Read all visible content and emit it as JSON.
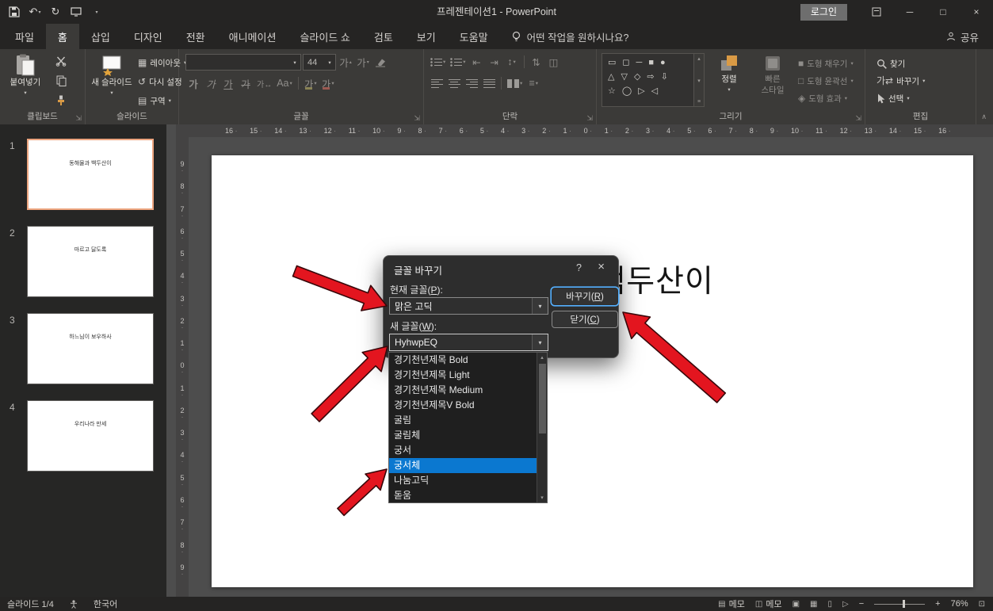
{
  "titlebar": {
    "title": "프레젠테이션1 - PowerPoint",
    "login_label": "로그인"
  },
  "ribbon_tabs": {
    "items": [
      {
        "label": "파일",
        "active": false
      },
      {
        "label": "홈",
        "active": true
      },
      {
        "label": "삽입",
        "active": false
      },
      {
        "label": "디자인",
        "active": false
      },
      {
        "label": "전환",
        "active": false
      },
      {
        "label": "애니메이션",
        "active": false
      },
      {
        "label": "슬라이드 쇼",
        "active": false
      },
      {
        "label": "검토",
        "active": false
      },
      {
        "label": "보기",
        "active": false
      },
      {
        "label": "도움말",
        "active": false
      }
    ],
    "tellme": "어떤 작업을 원하시나요?",
    "share_label": "공유"
  },
  "ribbon": {
    "clipboard": {
      "group_label": "클립보드",
      "paste_label": "붙여넣기"
    },
    "slides": {
      "group_label": "슬라이드",
      "new_slide_label": "새 슬라이드",
      "layout_label": "레이아웃",
      "reset_label": "다시 설정",
      "section_label": "구역"
    },
    "font": {
      "group_label": "글꼴",
      "font_name_value": "",
      "font_size_value": "44"
    },
    "paragraph": {
      "group_label": "단락"
    },
    "drawing": {
      "group_label": "그리기",
      "arrange_label": "정렬",
      "quick_styles_label_1": "빠른",
      "quick_styles_label_2": "스타일",
      "shape_fill_label": "도형 채우기",
      "shape_outline_label": "도형 윤곽선",
      "shape_effects_label": "도형 효과"
    },
    "editing": {
      "group_label": "편집",
      "find_label": "찾기",
      "replace_label": "바꾸기",
      "select_label": "선택"
    }
  },
  "slide_panel": {
    "slides": [
      {
        "number": "1",
        "title": "동해물과 백두산이",
        "selected": true
      },
      {
        "number": "2",
        "title": "마르고 닳도록",
        "selected": false
      },
      {
        "number": "3",
        "title": "하느님이 보우하사",
        "selected": false
      },
      {
        "number": "4",
        "title": "우리나라 만세",
        "selected": false
      }
    ]
  },
  "canvas": {
    "slide_title": "동해물과 백두산이"
  },
  "rulers": {
    "horizontal": [
      "16",
      "15",
      "14",
      "13",
      "12",
      "11",
      "10",
      "9",
      "8",
      "7",
      "6",
      "5",
      "4",
      "3",
      "2",
      "1",
      "0",
      "1",
      "2",
      "3",
      "4",
      "5",
      "6",
      "7",
      "8",
      "9",
      "10",
      "11",
      "12",
      "13",
      "14",
      "15",
      "16"
    ],
    "vertical": [
      "9",
      "8",
      "7",
      "6",
      "5",
      "4",
      "3",
      "2",
      "1",
      "0",
      "1",
      "2",
      "3",
      "4",
      "5",
      "6",
      "7",
      "8",
      "9"
    ]
  },
  "dialog": {
    "title": "글꼴 바꾸기",
    "help_label": "?",
    "current_font": {
      "pre": "현재 글꼴(",
      "key": "P",
      "suf": "):",
      "value": "맑은 고딕"
    },
    "new_font": {
      "pre": "새 글꼴(",
      "key": "W",
      "suf": "):",
      "value": "HyhwpEQ"
    },
    "font_list": [
      {
        "label": "경기천년제목 Bold",
        "selected": false
      },
      {
        "label": "경기천년제목 Light",
        "selected": false
      },
      {
        "label": "경기천년제목 Medium",
        "selected": false
      },
      {
        "label": "경기천년제목V Bold",
        "selected": false
      },
      {
        "label": "굴림",
        "selected": false
      },
      {
        "label": "굴림체",
        "selected": false
      },
      {
        "label": "궁서",
        "selected": false
      },
      {
        "label": "궁서체",
        "selected": true
      },
      {
        "label": "나눔고딕",
        "selected": false
      },
      {
        "label": "돋움",
        "selected": false
      }
    ],
    "replace_button": {
      "pre": "바꾸기(",
      "key": "R",
      "suf": ")"
    },
    "close_button": {
      "pre": "닫기(",
      "key": "C",
      "suf": ")"
    }
  },
  "statusbar": {
    "slide_counter": "슬라이드 1/4",
    "language": "한국어",
    "notes_label": "메모",
    "comments_label": "메모",
    "zoom_value": "76%"
  }
}
